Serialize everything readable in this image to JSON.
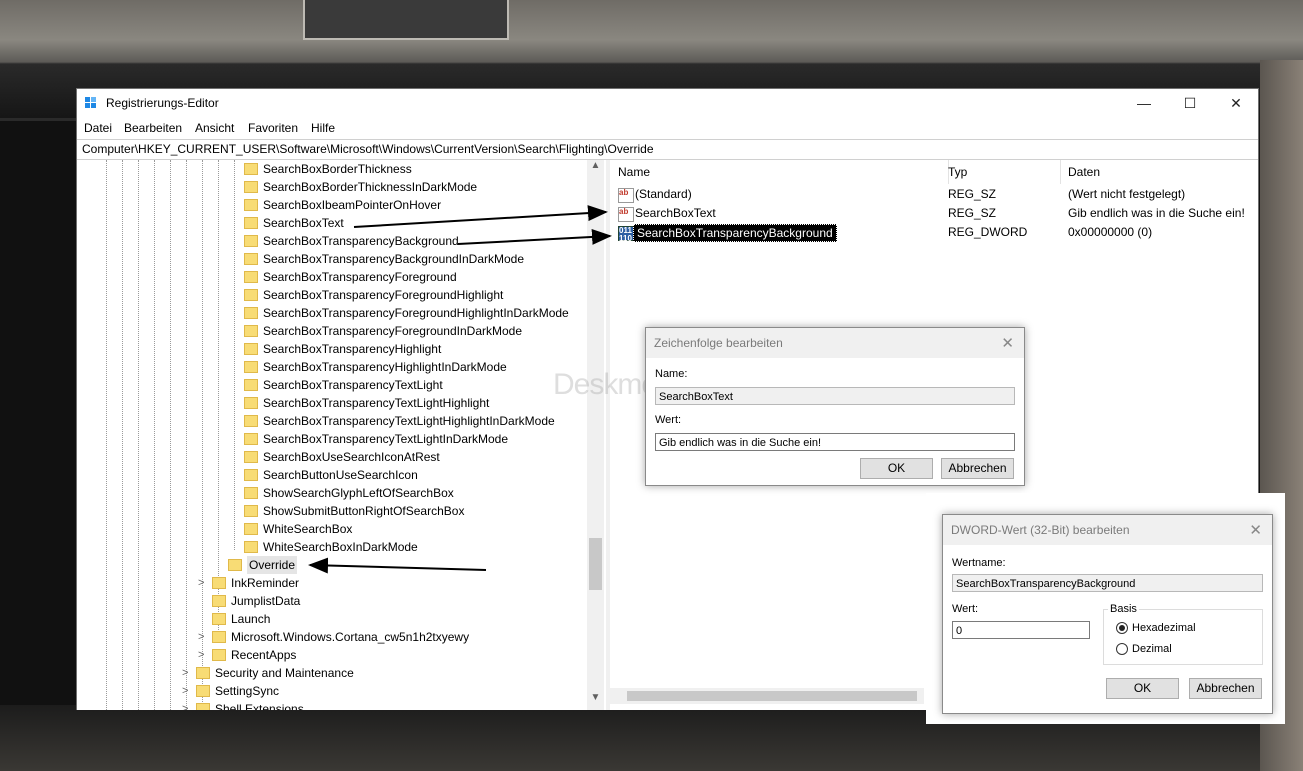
{
  "window": {
    "title": "Registrierungs-Editor",
    "minimize": "—",
    "maximize": "☐",
    "close": "✕"
  },
  "menu": [
    "Datei",
    "Bearbeiten",
    "Ansicht",
    "Favoriten",
    "Hilfe"
  ],
  "address": "Computer\\HKEY_CURRENT_USER\\Software\\Microsoft\\Windows\\CurrentVersion\\Search\\Flighting\\Override",
  "tree": {
    "override_children": [
      "SearchBoxBorderThickness",
      "SearchBoxBorderThicknessInDarkMode",
      "SearchBoxIbeamPointerOnHover",
      "SearchBoxText",
      "SearchBoxTransparencyBackground",
      "SearchBoxTransparencyBackgroundInDarkMode",
      "SearchBoxTransparencyForeground",
      "SearchBoxTransparencyForegroundHighlight",
      "SearchBoxTransparencyForegroundHighlightInDarkMode",
      "SearchBoxTransparencyForegroundInDarkMode",
      "SearchBoxTransparencyHighlight",
      "SearchBoxTransparencyHighlightInDarkMode",
      "SearchBoxTransparencyTextLight",
      "SearchBoxTransparencyTextLightHighlight",
      "SearchBoxTransparencyTextLightHighlightInDarkMode",
      "SearchBoxTransparencyTextLightInDarkMode",
      "SearchBoxUseSearchIconAtRest",
      "SearchButtonUseSearchIcon",
      "ShowSearchGlyphLeftOfSearchBox",
      "ShowSubmitButtonRightOfSearchBox",
      "WhiteSearchBox",
      "WhiteSearchBoxInDarkMode"
    ],
    "selected": "Override",
    "siblings": [
      "InkReminder",
      "JumplistData",
      "Launch",
      "Microsoft.Windows.Cortana_cw5n1h2txyewy",
      "RecentApps"
    ],
    "siblings_expandable": [
      true,
      false,
      false,
      true,
      true
    ],
    "upper": [
      "Security and Maintenance",
      "SettingSync",
      "Shell Extensions"
    ]
  },
  "list": {
    "headers": {
      "name": "Name",
      "type": "Typ",
      "data": "Daten"
    },
    "rows": [
      {
        "name": "(Standard)",
        "type": "REG_SZ",
        "data": "(Wert nicht festgelegt)",
        "icon": "string-value-icon"
      },
      {
        "name": "SearchBoxText",
        "type": "REG_SZ",
        "data": "Gib endlich was in die Suche ein!",
        "icon": "string-value-icon"
      },
      {
        "name": "SearchBoxTransparencyBackground",
        "type": "REG_DWORD",
        "data": "0x00000000 (0)",
        "icon": "dword-value-icon"
      }
    ]
  },
  "string_dialog": {
    "title": "Zeichenfolge bearbeiten",
    "name_label": "Name:",
    "name_value": "SearchBoxText",
    "value_label": "Wert:",
    "value_value": "Gib endlich was in die Suche ein!",
    "ok": "OK",
    "cancel": "Abbrechen"
  },
  "dword_dialog": {
    "title": "DWORD-Wert (32-Bit) bearbeiten",
    "name_label": "Wertname:",
    "name_value": "SearchBoxTransparencyBackground",
    "value_label": "Wert:",
    "value_value": "0",
    "base_label": "Basis",
    "hex_label": "Hexadezimal",
    "dec_label": "Dezimal",
    "ok": "OK",
    "cancel": "Abbrechen"
  },
  "watermark": "Deskmodder.de",
  "colors": {
    "folder": "#f8dc75",
    "selection": "#cce8ff",
    "accent": "#1e88e5"
  }
}
